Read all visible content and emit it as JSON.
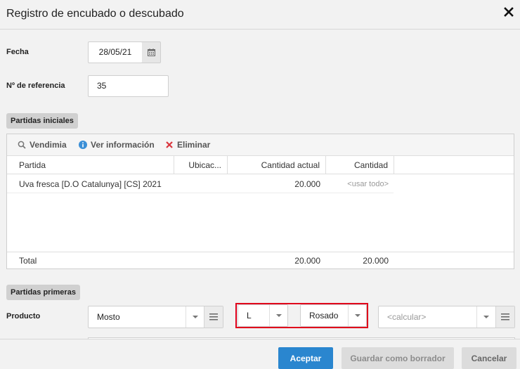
{
  "dialog": {
    "title": "Registro de encubado o descubado"
  },
  "form": {
    "fecha_label": "Fecha",
    "fecha_value": "28/05/21",
    "referencia_label": "Nº de referencia",
    "referencia_value": "35"
  },
  "partidas_iniciales": {
    "section_label": "Partidas iniciales",
    "toolbar": {
      "vendimia": "Vendimia",
      "ver_info": "Ver información",
      "eliminar": "Eliminar"
    },
    "columns": [
      "Partida",
      "Ubicac...",
      "Cantidad actual",
      "Cantidad"
    ],
    "rows": [
      {
        "partida": "Uva fresca [D.O Catalunya] [CS] 2021",
        "ubicacion": "",
        "cantidad_actual": "20.000",
        "cantidad": "<usar todo>"
      }
    ],
    "total": {
      "label": "Total",
      "cantidad_actual": "20.000",
      "cantidad": "20.000"
    }
  },
  "partidas_primeras": {
    "section_label": "Partidas primeras",
    "producto_label": "Producto",
    "producto_value": "Mosto",
    "unit_value": "L",
    "color_value": "Rosado",
    "calc_placeholder": "<calcular>"
  },
  "footer": {
    "aceptar": "Aceptar",
    "guardar": "Guardar como borrador",
    "cancelar": "Cancelar"
  },
  "colors": {
    "primary": "#2a86cf",
    "highlight": "#e0001b",
    "info_icon": "#3b8fd6",
    "delete_icon": "#d9363e"
  }
}
